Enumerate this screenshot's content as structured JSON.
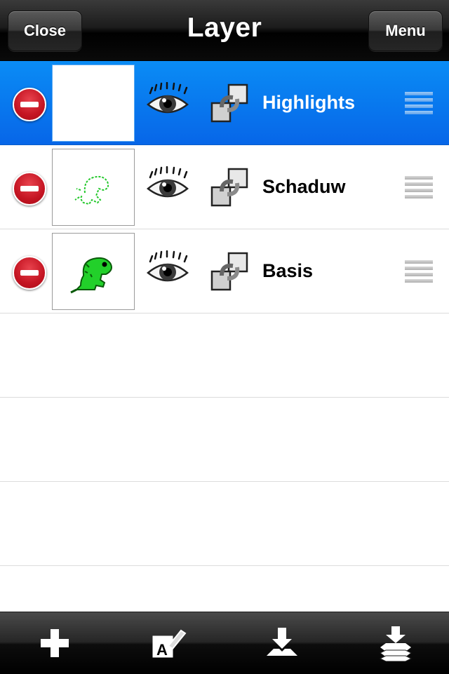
{
  "header": {
    "title": "Layer",
    "close_label": "Close",
    "menu_label": "Menu"
  },
  "layers": [
    {
      "name": "Highlights",
      "selected": true,
      "thumbnail": "blank",
      "visible": true
    },
    {
      "name": "Schaduw",
      "selected": false,
      "thumbnail": "dino-outline-green",
      "visible": true
    },
    {
      "name": "Basis",
      "selected": false,
      "thumbnail": "dino-green",
      "visible": true
    }
  ],
  "toolbar": {
    "icons": [
      "add-layer-icon",
      "edit-layer-icon",
      "merge-down-icon",
      "flatten-icon"
    ]
  },
  "colors": {
    "selected_row": "#0766e8",
    "delete": "#c41422",
    "dino": "#22d02a"
  }
}
